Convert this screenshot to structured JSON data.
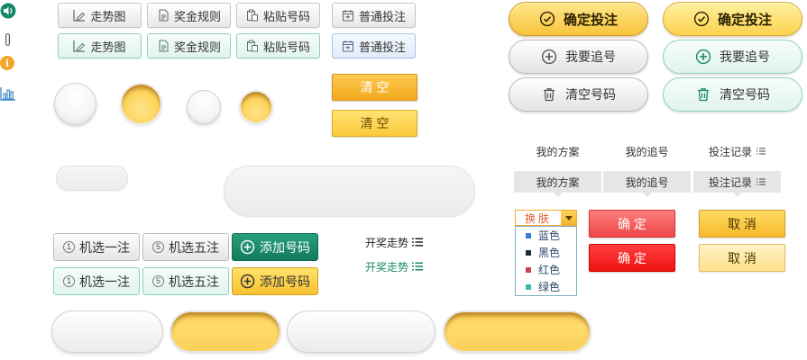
{
  "side_icons": {
    "speaker_icon": "speaker-icon",
    "capsule_icon": "capsule-icon",
    "info_icon": "info-icon",
    "info_glyph": "i",
    "chart_icon": "bar-chart-icon"
  },
  "tool_buttons": {
    "normal": [
      {
        "label": "走势图",
        "icon": "trend-chart-icon"
      },
      {
        "label": "奖金规则",
        "icon": "document-icon"
      },
      {
        "label": "粘贴号码",
        "icon": "paste-icon"
      },
      {
        "label": "普通投注",
        "icon": "calendar-icon"
      }
    ],
    "highlighted": [
      {
        "label": "走势图",
        "icon": "trend-chart-icon"
      },
      {
        "label": "奖金规则",
        "icon": "document-icon"
      },
      {
        "label": "粘贴号码",
        "icon": "paste-icon"
      },
      {
        "label": "普通投注",
        "icon": "calendar-icon"
      }
    ]
  },
  "action_buttons": {
    "confirm_bet": [
      {
        "label": "确定投注",
        "icon": "check-circle-icon"
      },
      {
        "label": "确定投注",
        "icon": "check-circle-icon"
      }
    ],
    "chase_number": [
      {
        "label": "我要追号",
        "icon": "plus-circle-icon"
      },
      {
        "label": "我要追号",
        "icon": "plus-circle-icon"
      }
    ],
    "clear_numbers": [
      {
        "label": "清空号码",
        "icon": "trash-icon"
      },
      {
        "label": "清空号码",
        "icon": "trash-icon"
      }
    ]
  },
  "clear_buttons": [
    {
      "label": "清 空"
    },
    {
      "label": "清 空"
    }
  ],
  "tabs": {
    "plain": [
      {
        "label": "我的方案"
      },
      {
        "label": "我的追号"
      },
      {
        "label": "投注记录",
        "icon": "list-icon"
      }
    ],
    "filled": [
      {
        "label": "我的方案"
      },
      {
        "label": "我的追号"
      },
      {
        "label": "投注记录",
        "icon": "list-icon"
      }
    ]
  },
  "skin_select": {
    "label": "换肤",
    "arrow_icon": "chevron-down-icon",
    "options": [
      {
        "label": "蓝色",
        "color": "#3a7bd5"
      },
      {
        "label": "黑色",
        "color": "#1f2d3d"
      },
      {
        "label": "红色",
        "color": "#c9404f"
      },
      {
        "label": "绿色",
        "color": "#3cbcab"
      }
    ]
  },
  "dialog_buttons": {
    "confirm": [
      {
        "label": "确 定"
      },
      {
        "label": "确 定"
      }
    ],
    "cancel": [
      {
        "label": "取 消"
      },
      {
        "label": "取 消"
      }
    ]
  },
  "pick_buttons": {
    "normal": [
      {
        "label": "机选一注",
        "badge": "1"
      },
      {
        "label": "机选五注",
        "badge": "5"
      },
      {
        "label": "添加号码",
        "icon": "plus-circle-icon"
      }
    ],
    "highlighted": [
      {
        "label": "机选一注",
        "badge": "1"
      },
      {
        "label": "机选五注",
        "badge": "5"
      },
      {
        "label": "添加号码",
        "icon": "plus-circle-icon"
      }
    ]
  },
  "trend_links": [
    {
      "label": "开奖走势",
      "icon": "list-icon"
    },
    {
      "label": "开奖走势",
      "icon": "list-icon"
    }
  ],
  "colors": {
    "gold": "#f8c43c",
    "gold_light": "#ffe68a",
    "brand_green": "#17886a",
    "mint_border": "#8fd1b8",
    "red": "#ef4747",
    "red_bright": "#f01212",
    "orange": "#f3a81f",
    "info_orange": "#f5a623",
    "chart_blue": "#2a78c0"
  }
}
